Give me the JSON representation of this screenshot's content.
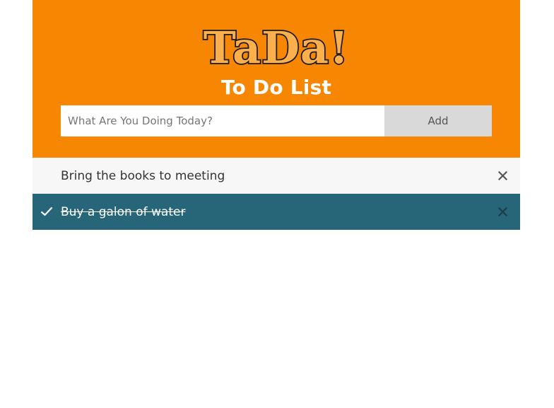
{
  "logo": {
    "text": "TaDa!"
  },
  "header": {
    "title": "To Do List"
  },
  "form": {
    "input_placeholder": "What Are You Doing Today?",
    "input_value": "",
    "add_label": "Add"
  },
  "tasks": [
    {
      "text": "Bring the books to meeting",
      "done": false,
      "remove_icon": "close-icon"
    },
    {
      "text": "Buy a galon of water",
      "done": true,
      "check_icon": "check-icon",
      "remove_icon": "close-icon"
    }
  ],
  "colors": {
    "header_bg": "#f78702",
    "logo_fill": "#fbb04d",
    "done_bg": "#276678",
    "pending_bg": "#f7f7f7",
    "add_button_bg": "#d9d9d9"
  }
}
